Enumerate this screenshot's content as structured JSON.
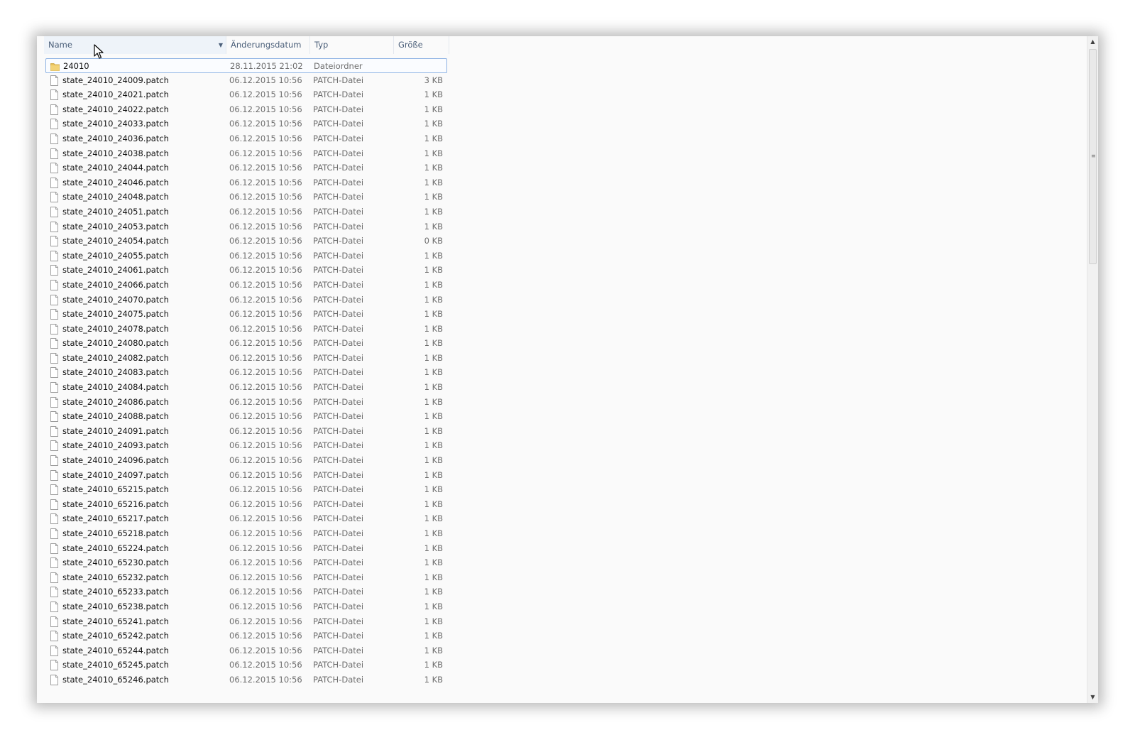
{
  "columns": {
    "name": "Name",
    "date": "Änderungsdatum",
    "type": "Typ",
    "size": "Größe"
  },
  "folder": {
    "name": "24010",
    "date": "28.11.2015 21:02",
    "type": "Dateiordner",
    "size": ""
  },
  "files": [
    {
      "name": "state_24010_24009.patch",
      "date": "06.12.2015 10:56",
      "type": "PATCH-Datei",
      "size": "3 KB"
    },
    {
      "name": "state_24010_24021.patch",
      "date": "06.12.2015 10:56",
      "type": "PATCH-Datei",
      "size": "1 KB"
    },
    {
      "name": "state_24010_24022.patch",
      "date": "06.12.2015 10:56",
      "type": "PATCH-Datei",
      "size": "1 KB"
    },
    {
      "name": "state_24010_24033.patch",
      "date": "06.12.2015 10:56",
      "type": "PATCH-Datei",
      "size": "1 KB"
    },
    {
      "name": "state_24010_24036.patch",
      "date": "06.12.2015 10:56",
      "type": "PATCH-Datei",
      "size": "1 KB"
    },
    {
      "name": "state_24010_24038.patch",
      "date": "06.12.2015 10:56",
      "type": "PATCH-Datei",
      "size": "1 KB"
    },
    {
      "name": "state_24010_24044.patch",
      "date": "06.12.2015 10:56",
      "type": "PATCH-Datei",
      "size": "1 KB"
    },
    {
      "name": "state_24010_24046.patch",
      "date": "06.12.2015 10:56",
      "type": "PATCH-Datei",
      "size": "1 KB"
    },
    {
      "name": "state_24010_24048.patch",
      "date": "06.12.2015 10:56",
      "type": "PATCH-Datei",
      "size": "1 KB"
    },
    {
      "name": "state_24010_24051.patch",
      "date": "06.12.2015 10:56",
      "type": "PATCH-Datei",
      "size": "1 KB"
    },
    {
      "name": "state_24010_24053.patch",
      "date": "06.12.2015 10:56",
      "type": "PATCH-Datei",
      "size": "1 KB"
    },
    {
      "name": "state_24010_24054.patch",
      "date": "06.12.2015 10:56",
      "type": "PATCH-Datei",
      "size": "0 KB"
    },
    {
      "name": "state_24010_24055.patch",
      "date": "06.12.2015 10:56",
      "type": "PATCH-Datei",
      "size": "1 KB"
    },
    {
      "name": "state_24010_24061.patch",
      "date": "06.12.2015 10:56",
      "type": "PATCH-Datei",
      "size": "1 KB"
    },
    {
      "name": "state_24010_24066.patch",
      "date": "06.12.2015 10:56",
      "type": "PATCH-Datei",
      "size": "1 KB"
    },
    {
      "name": "state_24010_24070.patch",
      "date": "06.12.2015 10:56",
      "type": "PATCH-Datei",
      "size": "1 KB"
    },
    {
      "name": "state_24010_24075.patch",
      "date": "06.12.2015 10:56",
      "type": "PATCH-Datei",
      "size": "1 KB"
    },
    {
      "name": "state_24010_24078.patch",
      "date": "06.12.2015 10:56",
      "type": "PATCH-Datei",
      "size": "1 KB"
    },
    {
      "name": "state_24010_24080.patch",
      "date": "06.12.2015 10:56",
      "type": "PATCH-Datei",
      "size": "1 KB"
    },
    {
      "name": "state_24010_24082.patch",
      "date": "06.12.2015 10:56",
      "type": "PATCH-Datei",
      "size": "1 KB"
    },
    {
      "name": "state_24010_24083.patch",
      "date": "06.12.2015 10:56",
      "type": "PATCH-Datei",
      "size": "1 KB"
    },
    {
      "name": "state_24010_24084.patch",
      "date": "06.12.2015 10:56",
      "type": "PATCH-Datei",
      "size": "1 KB"
    },
    {
      "name": "state_24010_24086.patch",
      "date": "06.12.2015 10:56",
      "type": "PATCH-Datei",
      "size": "1 KB"
    },
    {
      "name": "state_24010_24088.patch",
      "date": "06.12.2015 10:56",
      "type": "PATCH-Datei",
      "size": "1 KB"
    },
    {
      "name": "state_24010_24091.patch",
      "date": "06.12.2015 10:56",
      "type": "PATCH-Datei",
      "size": "1 KB"
    },
    {
      "name": "state_24010_24093.patch",
      "date": "06.12.2015 10:56",
      "type": "PATCH-Datei",
      "size": "1 KB"
    },
    {
      "name": "state_24010_24096.patch",
      "date": "06.12.2015 10:56",
      "type": "PATCH-Datei",
      "size": "1 KB"
    },
    {
      "name": "state_24010_24097.patch",
      "date": "06.12.2015 10:56",
      "type": "PATCH-Datei",
      "size": "1 KB"
    },
    {
      "name": "state_24010_65215.patch",
      "date": "06.12.2015 10:56",
      "type": "PATCH-Datei",
      "size": "1 KB"
    },
    {
      "name": "state_24010_65216.patch",
      "date": "06.12.2015 10:56",
      "type": "PATCH-Datei",
      "size": "1 KB"
    },
    {
      "name": "state_24010_65217.patch",
      "date": "06.12.2015 10:56",
      "type": "PATCH-Datei",
      "size": "1 KB"
    },
    {
      "name": "state_24010_65218.patch",
      "date": "06.12.2015 10:56",
      "type": "PATCH-Datei",
      "size": "1 KB"
    },
    {
      "name": "state_24010_65224.patch",
      "date": "06.12.2015 10:56",
      "type": "PATCH-Datei",
      "size": "1 KB"
    },
    {
      "name": "state_24010_65230.patch",
      "date": "06.12.2015 10:56",
      "type": "PATCH-Datei",
      "size": "1 KB"
    },
    {
      "name": "state_24010_65232.patch",
      "date": "06.12.2015 10:56",
      "type": "PATCH-Datei",
      "size": "1 KB"
    },
    {
      "name": "state_24010_65233.patch",
      "date": "06.12.2015 10:56",
      "type": "PATCH-Datei",
      "size": "1 KB"
    },
    {
      "name": "state_24010_65238.patch",
      "date": "06.12.2015 10:56",
      "type": "PATCH-Datei",
      "size": "1 KB"
    },
    {
      "name": "state_24010_65241.patch",
      "date": "06.12.2015 10:56",
      "type": "PATCH-Datei",
      "size": "1 KB"
    },
    {
      "name": "state_24010_65242.patch",
      "date": "06.12.2015 10:56",
      "type": "PATCH-Datei",
      "size": "1 KB"
    },
    {
      "name": "state_24010_65244.patch",
      "date": "06.12.2015 10:56",
      "type": "PATCH-Datei",
      "size": "1 KB"
    },
    {
      "name": "state_24010_65245.patch",
      "date": "06.12.2015 10:56",
      "type": "PATCH-Datei",
      "size": "1 KB"
    },
    {
      "name": "state_24010_65246.patch",
      "date": "06.12.2015 10:56",
      "type": "PATCH-Datei",
      "size": "1 KB"
    }
  ],
  "icons": {
    "folder": "folder-icon",
    "file": "file-icon",
    "sort": "sort-ascending-icon",
    "dropdown": "chevron-down-icon",
    "cursor": "mouse-cursor-icon"
  },
  "colors": {
    "header_text": "#4c607a",
    "selection_border": "#8db2e3",
    "folder": "#e8c15a"
  }
}
